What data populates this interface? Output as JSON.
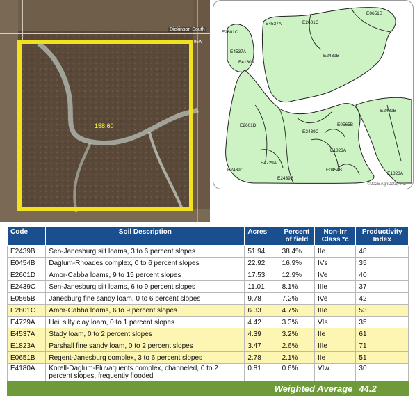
{
  "aerial": {
    "acres_label": "158.60",
    "road_label": "Dickinson South",
    "road_label2": "95W"
  },
  "soil_map": {
    "copyright": "©2025 AgriData, Inc.",
    "labels": [
      "E0651B",
      "E2601C",
      "E4537A",
      "E2601C",
      "E4537A",
      "E4180A",
      "E2439B",
      "E2439B",
      "E0565B",
      "E2601D",
      "E2439C",
      "E1823A",
      "E0454B",
      "E4729A",
      "E2439C",
      "E2439B",
      "E1823A"
    ]
  },
  "table": {
    "headers": {
      "code": "Code",
      "desc": "Soil Description",
      "acres": "Acres",
      "percent_l1": "Percent",
      "percent_l2": "of field",
      "nonirr_l1": "Non-Irr",
      "nonirr_l2": "Class *c",
      "prod_l1": "Productivity",
      "prod_l2": "Index"
    },
    "rows": [
      {
        "code": "E2439B",
        "desc": "Sen-Janesburg silt loams, 3 to 6 percent slopes",
        "acres": "51.94",
        "percent": "38.4%",
        "cls": "IIe",
        "pi": "48"
      },
      {
        "code": "E0454B",
        "desc": "Daglum-Rhoades complex, 0 to 6 percent slopes",
        "acres": "22.92",
        "percent": "16.9%",
        "cls": "IVs",
        "pi": "35"
      },
      {
        "code": "E2601D",
        "desc": "Amor-Cabba loams, 9 to 15 percent slopes",
        "acres": "17.53",
        "percent": "12.9%",
        "cls": "IVe",
        "pi": "40"
      },
      {
        "code": "E2439C",
        "desc": "Sen-Janesburg silt loams, 6 to 9 percent slopes",
        "acres": "11.01",
        "percent": "8.1%",
        "cls": "IIIe",
        "pi": "37"
      },
      {
        "code": "E0565B",
        "desc": "Janesburg fine sandy loam, 0 to 6 percent slopes",
        "acres": "9.78",
        "percent": "7.2%",
        "cls": "IVe",
        "pi": "42"
      },
      {
        "code": "E2601C",
        "desc": "Amor-Cabba loams, 6 to 9 percent slopes",
        "acres": "6.33",
        "percent": "4.7%",
        "cls": "IIIe",
        "pi": "53"
      },
      {
        "code": "E4729A",
        "desc": "Heil silty clay loam, 0 to 1 percent slopes",
        "acres": "4.42",
        "percent": "3.3%",
        "cls": "VIs",
        "pi": "35"
      },
      {
        "code": "E4537A",
        "desc": "Stady loam, 0 to 2 percent slopes",
        "acres": "4.39",
        "percent": "3.2%",
        "cls": "IIe",
        "pi": "61"
      },
      {
        "code": "E1823A",
        "desc": "Parshall fine sandy loam, 0 to 2 percent slopes",
        "acres": "3.47",
        "percent": "2.6%",
        "cls": "IIIe",
        "pi": "71"
      },
      {
        "code": "E0651B",
        "desc": "Regent-Janesburg complex, 3 to 6 percent slopes",
        "acres": "2.78",
        "percent": "2.1%",
        "cls": "IIe",
        "pi": "51"
      },
      {
        "code": "E4180A",
        "desc": "Korell-Daglum-Fluvaquents complex, channeled, 0 to 2 percent slopes, frequently flooded",
        "acres": "0.81",
        "percent": "0.6%",
        "cls": "VIw",
        "pi": "30"
      }
    ],
    "weighted_label": "Weighted Average",
    "weighted_value": "44.2"
  }
}
